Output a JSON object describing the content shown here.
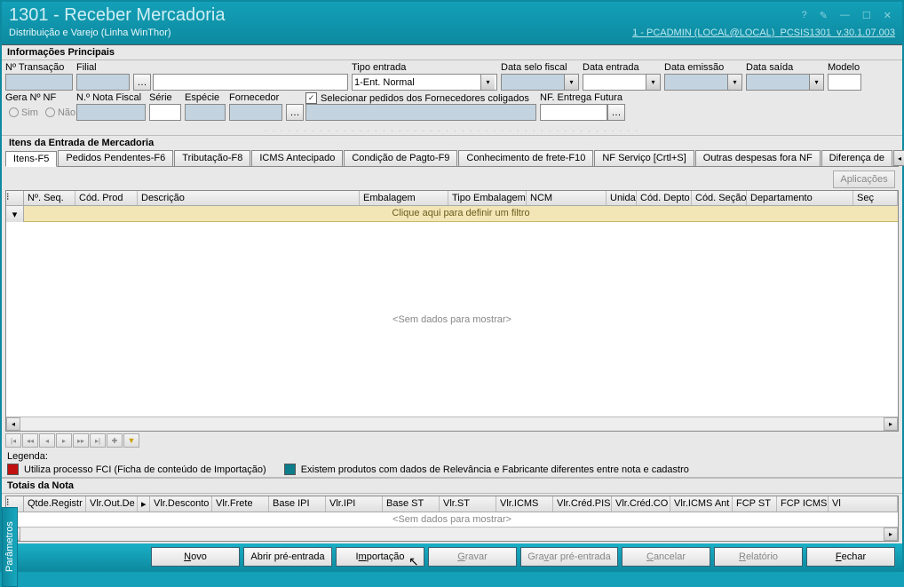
{
  "title": "1301 - Receber Mercadoria",
  "subtitle": "Distribuição e Varejo (Linha WinThor)",
  "connection": "1 - PCADMIN (LOCAL@LOCAL)",
  "appcode": "PCSIS1301",
  "version": "v.30.1.07.003",
  "info": {
    "heading": "Informações Principais",
    "labels": {
      "transacao": "Nº Transação",
      "filial": "Filial",
      "tipoEntrada": "Tipo entrada",
      "tipoEntradaValue": "1-Ent. Normal",
      "dataSelo": "Data selo fiscal",
      "dataEntrada": "Data entrada",
      "dataEmissao": "Data emissão",
      "dataSaida": "Data saída",
      "modelo": "Modelo",
      "geraNF": "Gera Nº NF",
      "sim": "Sim",
      "nao": "Não",
      "nNota": "N.º Nota Fiscal",
      "serie": "Série",
      "especie": "Espécie",
      "fornecedor": "Fornecedor",
      "checkColigados": "Selecionar pedidos dos Fornecedores coligados",
      "entregaFutura": "NF. Entrega Futura"
    }
  },
  "itens": {
    "heading": "Itens da Entrada de Mercadoria",
    "tabs": [
      "Itens-F5",
      "Pedidos Pendentes-F6",
      "Tributação-F8",
      "ICMS Antecipado",
      "Condição de Pagto-F9",
      "Conhecimento de frete-F10",
      "NF Serviço [Crtl+S]",
      "Outras despesas fora NF",
      "Diferença de"
    ],
    "aplicacoes": "Aplicações",
    "columns": [
      "Nº. Seq.",
      "Cód. Prod",
      "Descrição",
      "Embalagem",
      "Tipo Embalagem",
      "NCM",
      "Unida",
      "Cód. Depto",
      "Cód. Seção",
      "Departamento",
      "Seç"
    ],
    "filterHint": "Clique aqui para definir um filtro",
    "empty": "<Sem dados para mostrar>"
  },
  "legenda": {
    "heading": "Legenda:",
    "item1": "Utiliza processo FCI (Ficha de conteúdo de Importação)",
    "item2": "Existem produtos com dados de Relevância e Fabricante diferentes entre nota e cadastro",
    "color1": "#c01010",
    "color2": "#0d7d8c"
  },
  "totais": {
    "heading": "Totais da Nota",
    "columns": [
      "Qtde.Registr",
      "Vlr.Out.De",
      "Vlr.Desconto",
      "Vlr.Frete",
      "Base IPI",
      "Vlr.IPI",
      "Base ST",
      "Vlr.ST",
      "Vlr.ICMS",
      "Vlr.Créd.PIS",
      "Vlr.Créd.CO",
      "Vlr.ICMS Ant",
      "FCP ST",
      "FCP ICMS",
      "Vl"
    ],
    "empty": "<Sem dados para mostrar>"
  },
  "sideTab": "Parâmetros",
  "footer": {
    "novo": "Novo",
    "abrir": "Abrir pré-entrada",
    "importacao": "Importação",
    "gravar": "Gravar",
    "gravarPre": "Gravar pré-entrada",
    "cancelar": "Cancelar",
    "relatorio": "Relatório",
    "fechar": "Fechar"
  }
}
